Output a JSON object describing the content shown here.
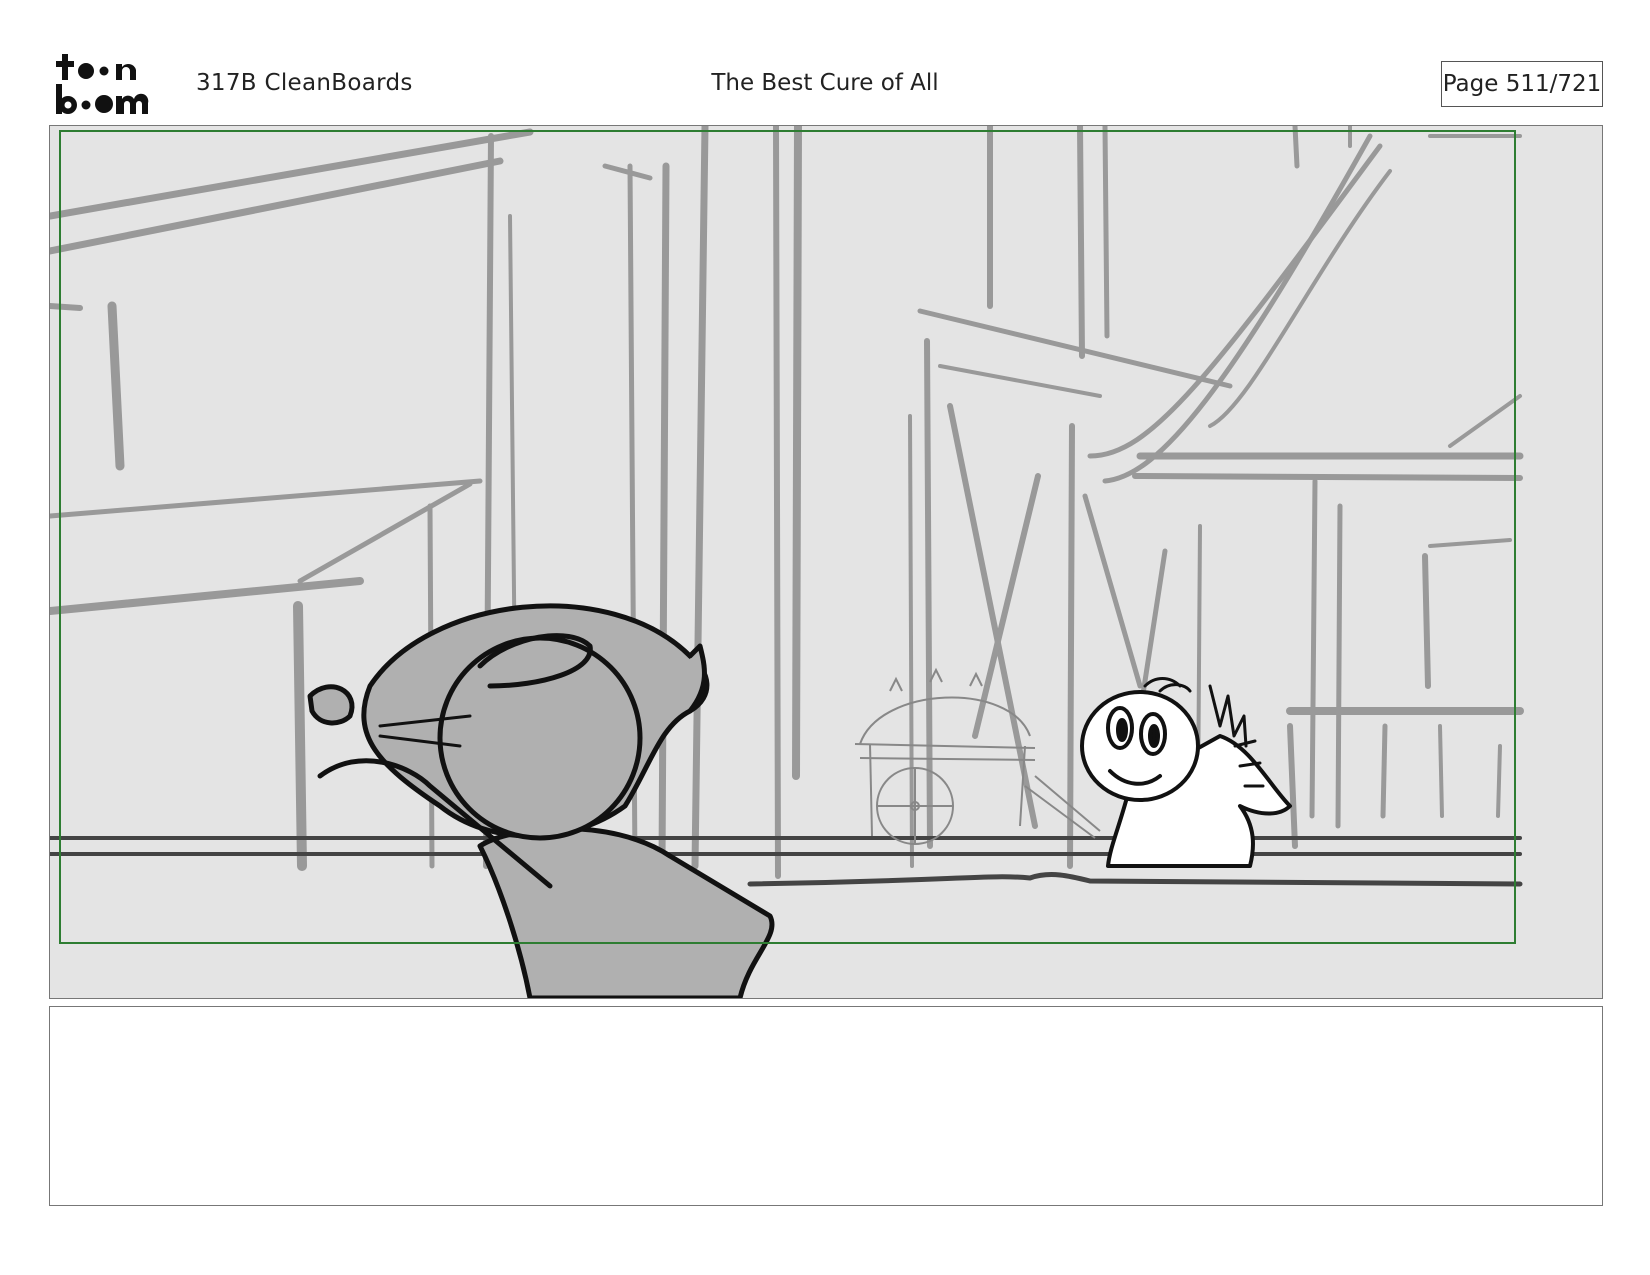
{
  "header": {
    "logo_text": "toon boom",
    "scene_id": "317B  CleanBoards",
    "title": "The Best Cure of All",
    "page": "Page 511/721"
  },
  "panel": {
    "background_color": "#e4e4e4",
    "safe_frame_color": "#2e7d32"
  },
  "notes": {
    "text": ""
  }
}
